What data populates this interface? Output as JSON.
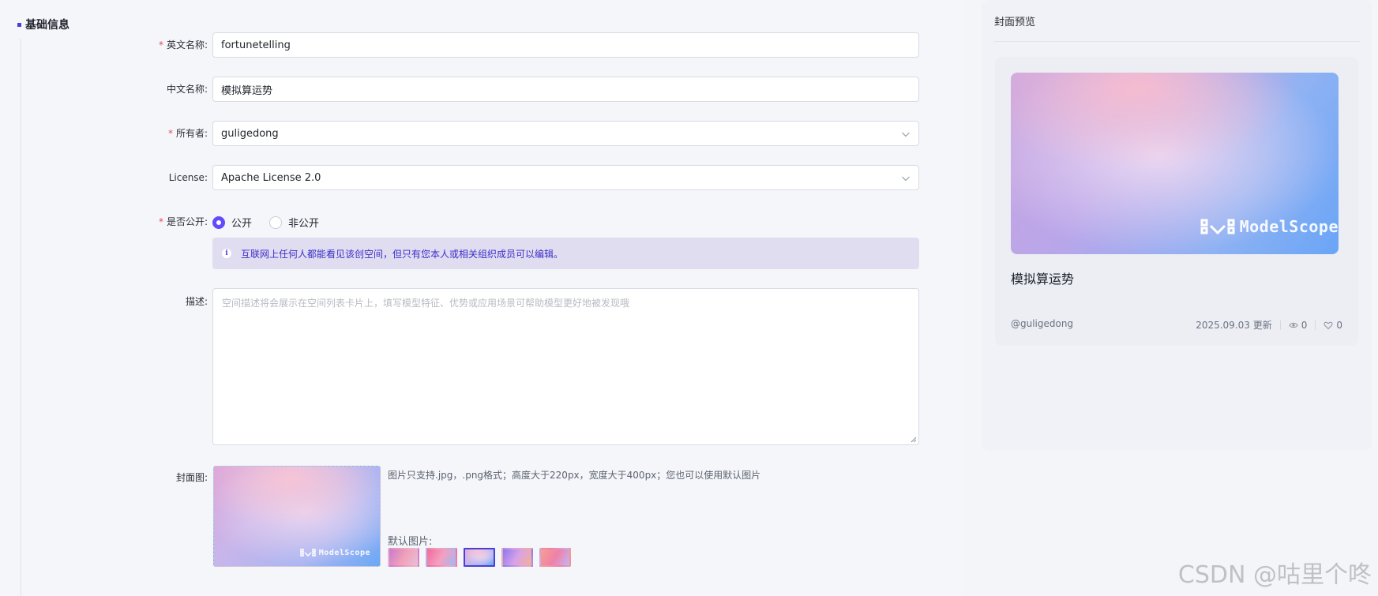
{
  "section": {
    "title": "基础信息"
  },
  "form": {
    "english_name": {
      "label": "英文名称:",
      "value": "fortunetelling",
      "required": true
    },
    "chinese_name": {
      "label": "中文名称:",
      "value": "模拟算运势",
      "required": false
    },
    "owner": {
      "label": "所有者:",
      "value": "guligedong",
      "required": true
    },
    "license": {
      "label": "License:",
      "value": "Apache License 2.0",
      "required": false
    },
    "visibility": {
      "label": "是否公开:",
      "required": true,
      "options": [
        "公开",
        "非公开"
      ],
      "selected": "公开",
      "notice": "互联网上任何人都能看见该创空间，但只有您本人或相关组织成员可以编辑。"
    },
    "description": {
      "label": "描述:",
      "placeholder": "空间描述将会展示在空间列表卡片上，填写模型特征、优势或应用场景可帮助模型更好地被发现哦"
    },
    "cover": {
      "label": "封面图:",
      "hint": "图片只支持.jpg，.png格式；高度大于220px，宽度大于400px；您也可以使用默认图片",
      "default_label": "默认图片:",
      "logo_text": "ModelScope",
      "selected_default_index": 2
    },
    "required_mark": "*"
  },
  "preview": {
    "title": "封面预览",
    "card": {
      "title": "模拟算运势",
      "owner": "@guligedong",
      "updated": "2025.09.03 更新",
      "views": "0",
      "likes": "0",
      "logo_text": "ModelScope"
    }
  },
  "watermark": "CSDN @咕里个咚",
  "colors": {
    "accent": "#624aff",
    "required": "#e34d59",
    "notice_bg": "#e0ddf1",
    "notice_text": "#3b2fc7"
  }
}
